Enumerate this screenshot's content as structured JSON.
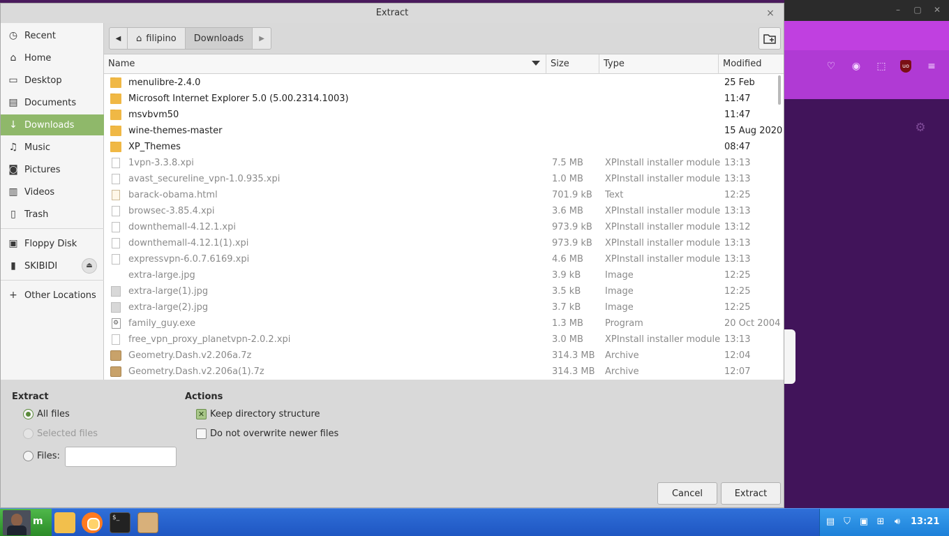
{
  "dialog": {
    "title": "Extract",
    "close_glyph": "×"
  },
  "sidebar": {
    "items": [
      {
        "label": "Recent",
        "icon": "clock-icon"
      },
      {
        "label": "Home",
        "icon": "home-icon"
      },
      {
        "label": "Desktop",
        "icon": "desktop-icon"
      },
      {
        "label": "Documents",
        "icon": "documents-icon"
      },
      {
        "label": "Downloads",
        "icon": "download-icon"
      },
      {
        "label": "Music",
        "icon": "music-icon"
      },
      {
        "label": "Pictures",
        "icon": "camera-icon"
      },
      {
        "label": "Videos",
        "icon": "film-icon"
      },
      {
        "label": "Trash",
        "icon": "trash-icon"
      },
      {
        "label": "Floppy Disk",
        "icon": "drive-icon"
      },
      {
        "label": "SKIBIDI",
        "icon": "usb-drive-icon"
      },
      {
        "label": "Other Locations",
        "icon": "plus-icon"
      }
    ],
    "active": "Downloads"
  },
  "pathbar": {
    "segments": [
      "filipino",
      "Downloads"
    ]
  },
  "columns": {
    "name": "Name",
    "size": "Size",
    "type": "Type",
    "modified": "Modified"
  },
  "files": [
    {
      "name": "menulibre-2.4.0",
      "size": "",
      "type": "",
      "modified": "25 Feb",
      "kind": "folder"
    },
    {
      "name": "Microsoft Internet Explorer 5.0 (5.00.2314.1003)",
      "size": "",
      "type": "",
      "modified": "11:47",
      "kind": "folder"
    },
    {
      "name": "msvbvm50",
      "size": "",
      "type": "",
      "modified": "11:47",
      "kind": "folder"
    },
    {
      "name": "wine-themes-master",
      "size": "",
      "type": "",
      "modified": "15 Aug 2020",
      "kind": "folder"
    },
    {
      "name": "XP_Themes",
      "size": "",
      "type": "",
      "modified": "08:47",
      "kind": "folder"
    },
    {
      "name": "1vpn-3.3.8.xpi",
      "size": "7.5 MB",
      "type": "XPInstall installer module",
      "modified": "13:13",
      "kind": "file"
    },
    {
      "name": "avast_secureline_vpn-1.0.935.xpi",
      "size": "1.0 MB",
      "type": "XPInstall installer module",
      "modified": "13:13",
      "kind": "file"
    },
    {
      "name": "barack-obama.html",
      "size": "701.9 kB",
      "type": "Text",
      "modified": "12:25",
      "kind": "html"
    },
    {
      "name": "browsec-3.85.4.xpi",
      "size": "3.6 MB",
      "type": "XPInstall installer module",
      "modified": "13:13",
      "kind": "file"
    },
    {
      "name": "downthemall-4.12.1.xpi",
      "size": "973.9 kB",
      "type": "XPInstall installer module",
      "modified": "13:12",
      "kind": "file"
    },
    {
      "name": "downthemall-4.12.1(1).xpi",
      "size": "973.9 kB",
      "type": "XPInstall installer module",
      "modified": "13:13",
      "kind": "file"
    },
    {
      "name": "expressvpn-6.0.7.6169.xpi",
      "size": "4.6 MB",
      "type": "XPInstall installer module",
      "modified": "13:13",
      "kind": "file"
    },
    {
      "name": "extra-large.jpg",
      "size": "3.9 kB",
      "type": "Image",
      "modified": "12:25",
      "kind": "blank"
    },
    {
      "name": "extra-large(1).jpg",
      "size": "3.5 kB",
      "type": "Image",
      "modified": "12:25",
      "kind": "image"
    },
    {
      "name": "extra-large(2).jpg",
      "size": "3.7 kB",
      "type": "Image",
      "modified": "12:25",
      "kind": "image"
    },
    {
      "name": "family_guy.exe",
      "size": "1.3 MB",
      "type": "Program",
      "modified": "20 Oct 2004",
      "kind": "exe"
    },
    {
      "name": "free_vpn_proxy_planetvpn-2.0.2.xpi",
      "size": "3.0 MB",
      "type": "XPInstall installer module",
      "modified": "13:13",
      "kind": "file"
    },
    {
      "name": "Geometry.Dash.v2.206a.7z",
      "size": "314.3 MB",
      "type": "Archive",
      "modified": "12:04",
      "kind": "archive"
    },
    {
      "name": "Geometry.Dash.v2.206a(1).7z",
      "size": "314.3 MB",
      "type": "Archive",
      "modified": "12:07",
      "kind": "archive"
    }
  ],
  "options": {
    "extract_heading": "Extract",
    "all_files": "All files",
    "selected_files": "Selected files",
    "files_label": "Files:",
    "files_value": "",
    "actions_heading": "Actions",
    "keep_structure": "Keep directory structure",
    "no_overwrite": "Do not overwrite newer files"
  },
  "buttons": {
    "cancel": "Cancel",
    "extract": "Extract"
  },
  "taskbar": {
    "start_label": "m",
    "clock": "13:21",
    "terminal_prompt": "$_"
  },
  "colors": {
    "accent": "#8fb86a",
    "taskbar": "#2f6fd8",
    "browser_bg": "#41145a"
  }
}
